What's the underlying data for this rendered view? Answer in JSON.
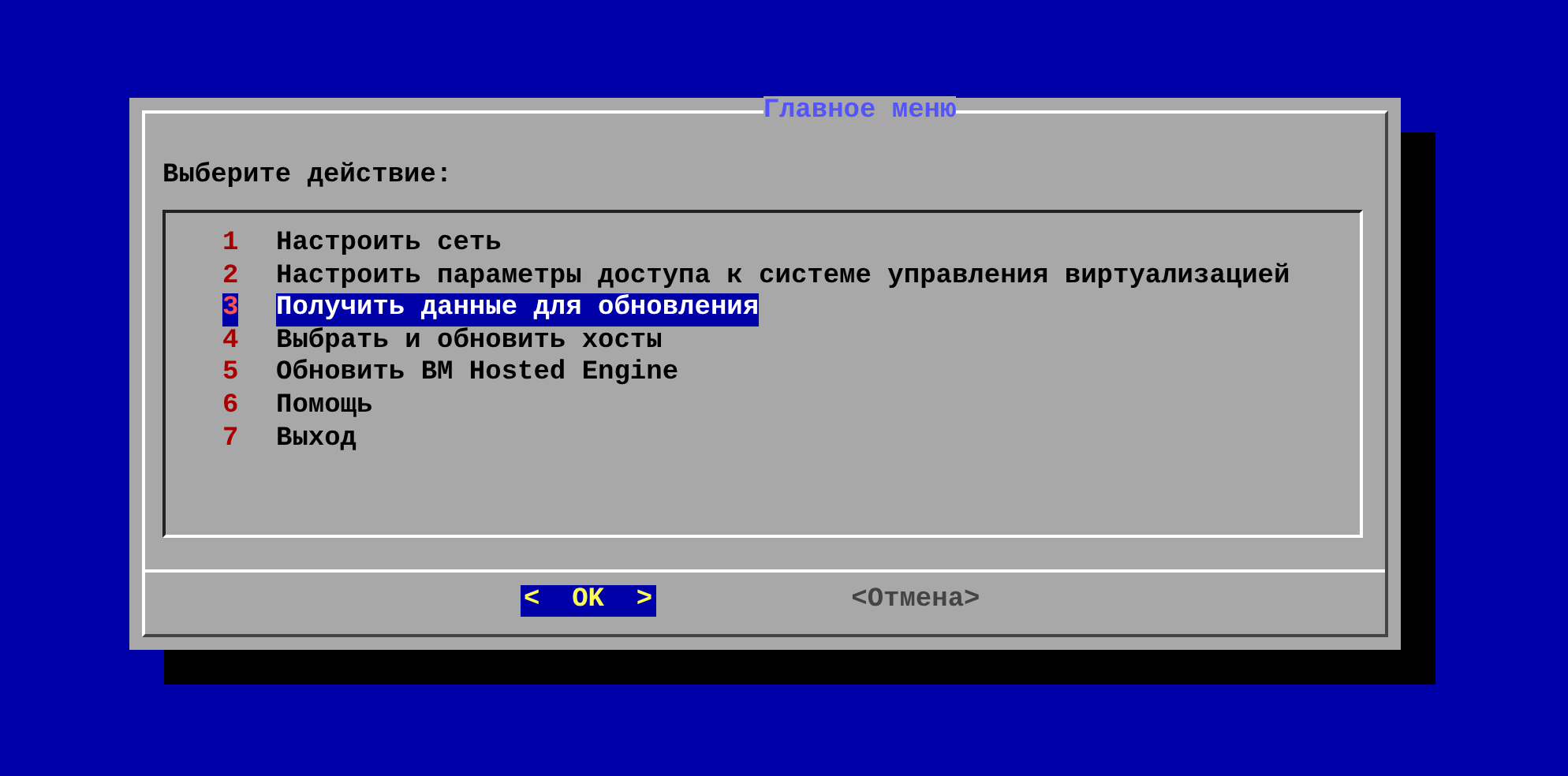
{
  "dialog": {
    "title": "Главное меню",
    "prompt": "Выберите действие:"
  },
  "menu": [
    {
      "tag": "1",
      "label": "Настроить сеть",
      "selected": false
    },
    {
      "tag": "2",
      "label": "Настроить параметры доступа к системе управления виртуализацией",
      "selected": false
    },
    {
      "tag": "3",
      "label": "Получить данные для обновления",
      "selected": true
    },
    {
      "tag": "4",
      "label": "Выбрать и обновить хосты",
      "selected": false
    },
    {
      "tag": "5",
      "label": "Обновить BM Hosted Engine",
      "selected": false
    },
    {
      "tag": "6",
      "label": "Помощь",
      "selected": false
    },
    {
      "tag": "7",
      "label": "Выход",
      "selected": false
    }
  ],
  "buttons": [
    {
      "label": "<  OK  >",
      "selected": true
    },
    {
      "label": "<Отмена>",
      "selected": false
    }
  ]
}
